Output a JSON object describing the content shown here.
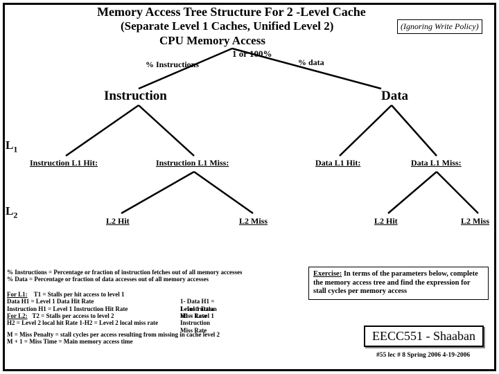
{
  "title_line1": "Memory Access Tree Structure For 2 -Level Cache",
  "title_line2": "(Separate Level 1 Caches, Unified Level 2)",
  "ignoring_note": "(Ignoring Write Policy)",
  "title_line3": "CPU Memory  Access",
  "pct_instructions": "% Instructions",
  "one_or_100": "1 or 100%",
  "pct_data": "% data",
  "node_instruction": "Instruction",
  "node_data": "Data",
  "l1_label": "L",
  "l1_sub": "1",
  "l2_label": "L",
  "l2_sub": "2",
  "leaves": {
    "instr_l1_hit": "Instruction L1  Hit:",
    "instr_l1_miss": "Instruction L1  Miss:",
    "data_l1_hit": "Data L1 Hit:",
    "data_l1_miss": "Data L1 Miss:",
    "l2_hit_left": "L2 Hit",
    "l2_miss_left": "L2  Miss",
    "l2_hit_right": "L2 Hit",
    "l2_miss_right": "L2  Miss"
  },
  "defs_instr": "% Instructions = Percentage or fraction of instruction fetches out of all memory accesses",
  "defs_data": "% Data = Percentage or fraction of  data accesses out of all memory accesses",
  "for_l1": "For L1:",
  "for_l1_t1": "T1  =   Stalls per hit access to level 1",
  "for_l1_dh1": "Data H1  =  Level 1  Data Hit Rate",
  "for_l1_ih1": "Instruction H1  =  Level 1  Instruction Hit Rate",
  "for_l1_dm1": "1- Data H1  =  Level 1 Data Miss Rate",
  "for_l1_im1": "1- Instruction H1  =  Level 1 Instruction Miss Rate",
  "for_l2": "For  L2:",
  "for_l2_t2": "T2  = Stalls per access to level 2",
  "for_l2_h2": "H2  =   Level 2 local hit Rate       1-H2   =  Level 2 local miss rate",
  "m_line": "M  = Miss Penalty = stall cycles per access resulting from missing in cache level 2",
  "m1_line": "M + 1 =   Miss Time =  Main memory access time",
  "exercise_label": "Exercise:",
  "exercise_body": "In terms of the parameters below, complete the memory access tree and find the expression for stall cycles per memory access",
  "course": "EECC551 - Shaaban",
  "footer": "#55  lec # 8    Spring 2006  4-19-2006"
}
